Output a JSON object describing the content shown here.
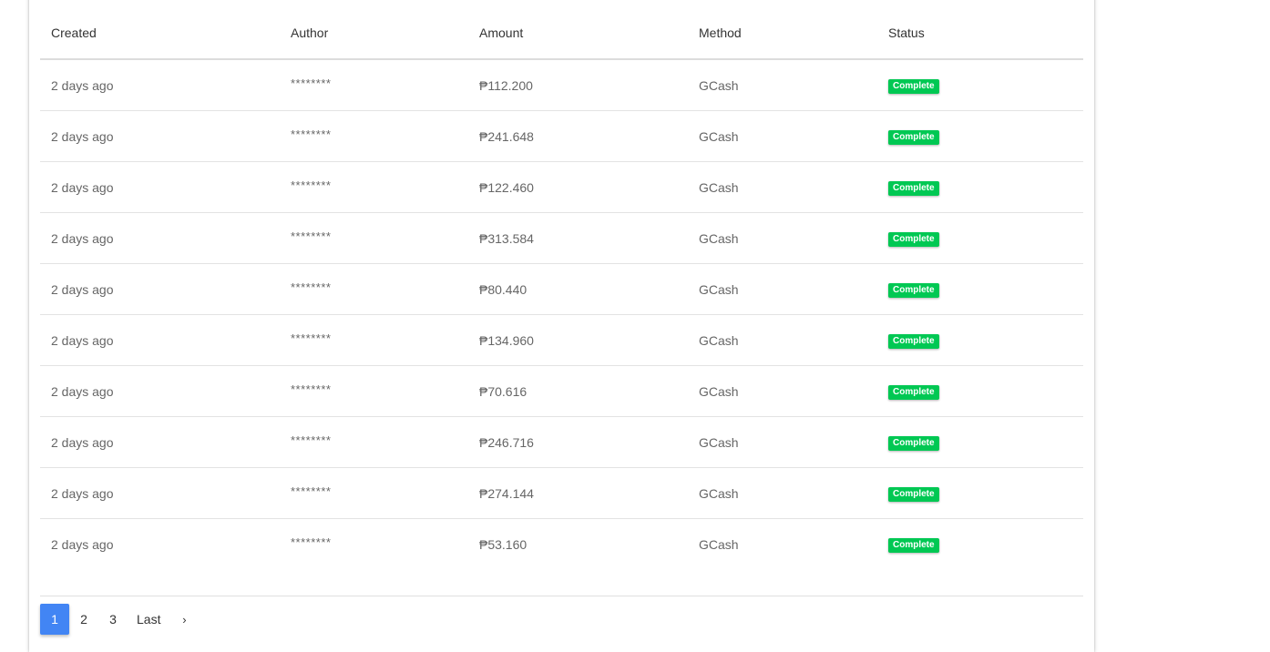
{
  "table": {
    "columns": [
      "Created",
      "Author",
      "Amount",
      "Method",
      "Status"
    ],
    "rows": [
      {
        "created": "2 days ago",
        "author": "********",
        "amount": "₱112.200",
        "method": "GCash",
        "status": "Complete"
      },
      {
        "created": "2 days ago",
        "author": "********",
        "amount": "₱241.648",
        "method": "GCash",
        "status": "Complete"
      },
      {
        "created": "2 days ago",
        "author": "********",
        "amount": "₱122.460",
        "method": "GCash",
        "status": "Complete"
      },
      {
        "created": "2 days ago",
        "author": "********",
        "amount": "₱313.584",
        "method": "GCash",
        "status": "Complete"
      },
      {
        "created": "2 days ago",
        "author": "********",
        "amount": "₱80.440",
        "method": "GCash",
        "status": "Complete"
      },
      {
        "created": "2 days ago",
        "author": "********",
        "amount": "₱134.960",
        "method": "GCash",
        "status": "Complete"
      },
      {
        "created": "2 days ago",
        "author": "********",
        "amount": "₱70.616",
        "method": "GCash",
        "status": "Complete"
      },
      {
        "created": "2 days ago",
        "author": "********",
        "amount": "₱246.716",
        "method": "GCash",
        "status": "Complete"
      },
      {
        "created": "2 days ago",
        "author": "********",
        "amount": "₱274.144",
        "method": "GCash",
        "status": "Complete"
      },
      {
        "created": "2 days ago",
        "author": "********",
        "amount": "₱53.160",
        "method": "GCash",
        "status": "Complete"
      }
    ]
  },
  "pagination": {
    "pages": [
      "1",
      "2",
      "3"
    ],
    "active_page": "1",
    "last_label": "Last",
    "next_glyph": "›"
  },
  "colors": {
    "status_complete": "#00c853",
    "active_page": "#4285f4"
  }
}
